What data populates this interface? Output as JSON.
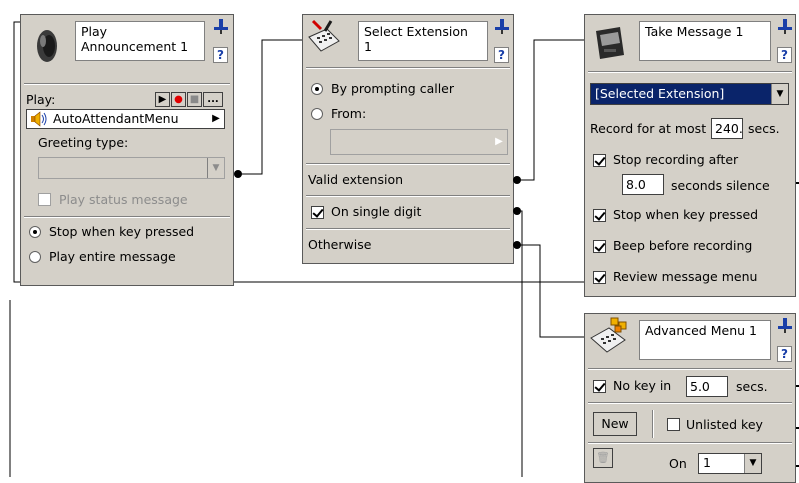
{
  "play_node": {
    "title": "Play\nAnnouncement 1",
    "play_label": "Play:",
    "prompt_value": "AutoAttendantMenu",
    "controls": [
      "▶",
      "●",
      "■",
      "..."
    ],
    "greeting_label": "Greeting type:",
    "status_label": "Play status message",
    "options": [
      "Stop when key pressed",
      "Play entire message"
    ],
    "selected_option": 0
  },
  "select_node": {
    "title": "Select Extension\n1",
    "options": [
      "By prompting caller",
      "From:"
    ],
    "selected_option": 0,
    "exits": [
      "Valid extension",
      "On single digit",
      "Otherwise"
    ],
    "single_digit_checked": true
  },
  "take_node": {
    "title": "Take Message 1",
    "mailbox_value": "[Selected Extension]",
    "record_prefix": "Record for at most",
    "record_value": "240.0",
    "record_unit": "secs.",
    "stop_after_label": "Stop recording after",
    "silence_value": "8.0",
    "silence_label": "seconds silence",
    "checks": [
      "Stop when key pressed",
      "Beep before recording",
      "Review message menu"
    ]
  },
  "adv_node": {
    "title": "Advanced Menu 1",
    "nokey_label": "No key in",
    "nokey_value": "5.0",
    "nokey_unit": "secs.",
    "new_label": "New",
    "unlisted_label": "Unlisted key",
    "on_label": "On",
    "on_value": "1"
  },
  "colors": {
    "node_bg": "#d4d0c8",
    "selection": "#0a246a",
    "record": "#e00000"
  }
}
